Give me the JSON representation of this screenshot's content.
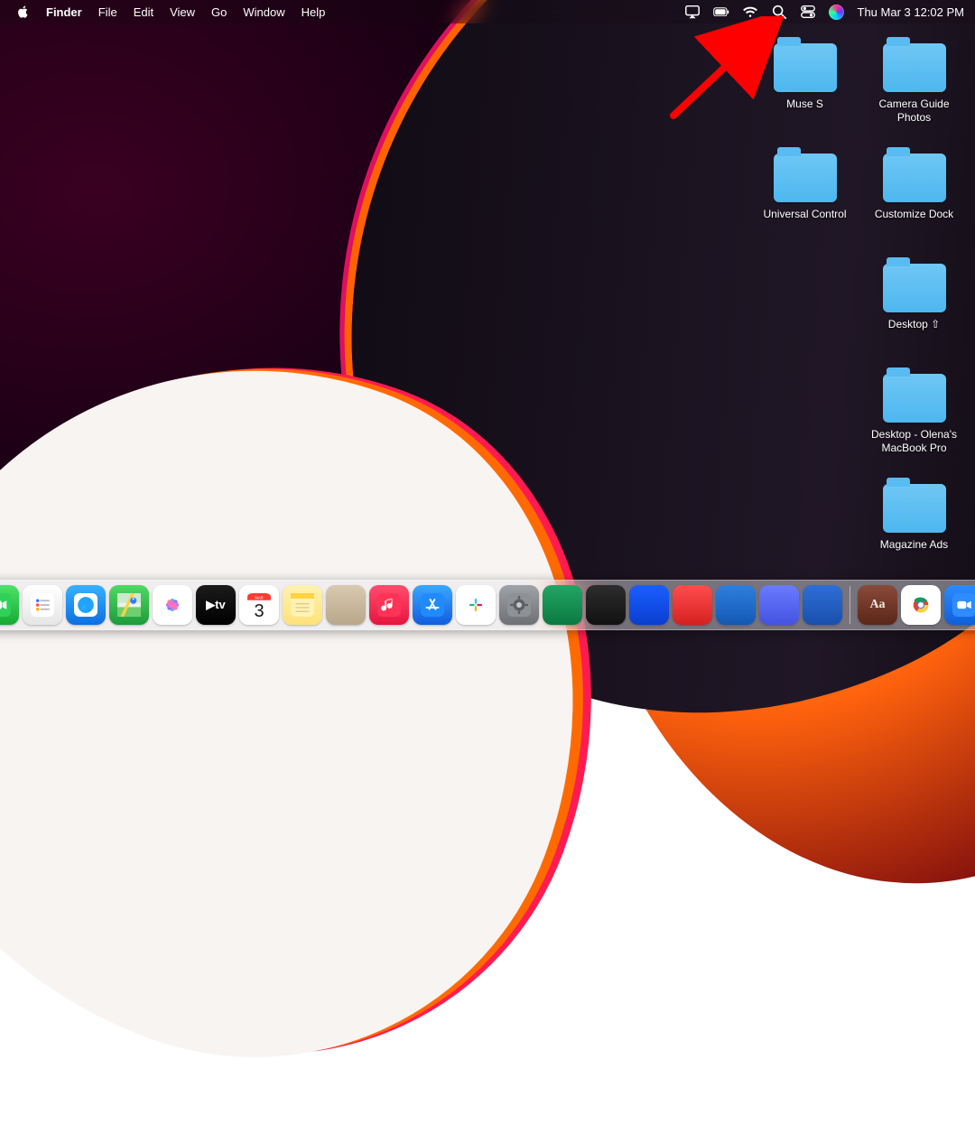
{
  "menubar": {
    "app_name": "Finder",
    "menus": [
      "File",
      "Edit",
      "View",
      "Go",
      "Window",
      "Help"
    ],
    "clock": "Thu Mar 3  12:02 PM",
    "status_icons": [
      "screen-mirroring",
      "battery",
      "wifi",
      "spotlight",
      "control-center",
      "siri"
    ]
  },
  "desktop": {
    "folders": [
      {
        "slot": "c1r1",
        "label": "Muse S"
      },
      {
        "slot": "c2r1",
        "label": "Camera Guide Photos"
      },
      {
        "slot": "c1r2",
        "label": "Universal Control"
      },
      {
        "slot": "c2r2",
        "label": "Customize Dock"
      },
      {
        "slot": "c2r3",
        "label": "Desktop ⇧"
      },
      {
        "slot": "c2r4",
        "label": "Desktop - Olena's MacBook Pro"
      },
      {
        "slot": "c2r5",
        "label": "Magazine Ads"
      }
    ]
  },
  "annotation": {
    "target_icon": "control-center"
  },
  "dock": {
    "apps": [
      {
        "name": "finder",
        "bg1": "#2aa8ff",
        "bg2": "#0e63d6",
        "label": ""
      },
      {
        "name": "launchpad",
        "bg1": "#e9e9ee",
        "bg2": "#cfcfd6",
        "label": ""
      },
      {
        "name": "messages",
        "bg1": "#5ef27a",
        "bg2": "#1dbf3e",
        "label": ""
      },
      {
        "name": "mail",
        "bg1": "#3aa7ff",
        "bg2": "#1468e6",
        "label": ""
      },
      {
        "name": "facetime",
        "bg1": "#4ce46a",
        "bg2": "#17a934",
        "label": ""
      },
      {
        "name": "reminders",
        "bg1": "#ffffff",
        "bg2": "#e6e6e6",
        "label": ""
      },
      {
        "name": "safari",
        "bg1": "#38b1ff",
        "bg2": "#0d6fe0",
        "label": ""
      },
      {
        "name": "maps",
        "bg1": "#4fd964",
        "bg2": "#1e9b3b",
        "label": ""
      },
      {
        "name": "photos",
        "bg1": "#ffffff",
        "bg2": "#ffffff",
        "label": ""
      },
      {
        "name": "appletv",
        "bg1": "#1b1b1b",
        "bg2": "#000000",
        "label": "tv"
      },
      {
        "name": "calendar",
        "bg1": "#ffffff",
        "bg2": "#ffffff",
        "label": "3"
      },
      {
        "name": "notes",
        "bg1": "#fff2b0",
        "bg2": "#ffe17a",
        "label": ""
      },
      {
        "name": "contacts",
        "bg1": "#d8c9b0",
        "bg2": "#b9a78a",
        "label": ""
      },
      {
        "name": "music",
        "bg1": "#ff4d6d",
        "bg2": "#e5163f",
        "label": ""
      },
      {
        "name": "appstore",
        "bg1": "#3aa7ff",
        "bg2": "#125de0",
        "label": ""
      },
      {
        "name": "slack",
        "bg1": "#ffffff",
        "bg2": "#ffffff",
        "label": ""
      },
      {
        "name": "preferences",
        "bg1": "#9fa3a7",
        "bg2": "#6d7074",
        "label": ""
      },
      {
        "name": "excel",
        "bg1": "#23a566",
        "bg2": "#0b7a42",
        "label": ""
      },
      {
        "name": "activity",
        "bg1": "#2d2d2d",
        "bg2": "#111111",
        "label": ""
      },
      {
        "name": "1password",
        "bg1": "#1a5eff",
        "bg2": "#0a3fcf",
        "label": ""
      },
      {
        "name": "todoist",
        "bg1": "#ff4d4d",
        "bg2": "#d62020",
        "label": ""
      },
      {
        "name": "outlook",
        "bg1": "#2d7fe0",
        "bg2": "#1459b3",
        "label": ""
      },
      {
        "name": "discord",
        "bg1": "#6a7bff",
        "bg2": "#4453e0",
        "label": ""
      },
      {
        "name": "word",
        "bg1": "#2d6fd6",
        "bg2": "#1a4fad",
        "label": ""
      }
    ],
    "after_sep1": [
      {
        "name": "dictionary",
        "bg1": "#8a4a3a",
        "bg2": "#5a2718",
        "label": "Aa"
      },
      {
        "name": "chrome",
        "bg1": "#ffffff",
        "bg2": "#ffffff",
        "label": ""
      },
      {
        "name": "zoom",
        "bg1": "#2d8cff",
        "bg2": "#0f60d8",
        "label": ""
      }
    ],
    "after_sep2": [
      {
        "name": "recent-1",
        "bg1": "#d7dde3",
        "bg2": "#b9c2ca",
        "label": ""
      },
      {
        "name": "recent-2",
        "bg1": "#e9ecef",
        "bg2": "#cfd4d9",
        "label": ""
      },
      {
        "name": "downloads",
        "bg1": "#cfeaf7",
        "bg2": "#a9d9f0",
        "label": ""
      },
      {
        "name": "trash",
        "bg1": "#eef0f2",
        "bg2": "#d4d8db",
        "label": ""
      }
    ]
  }
}
